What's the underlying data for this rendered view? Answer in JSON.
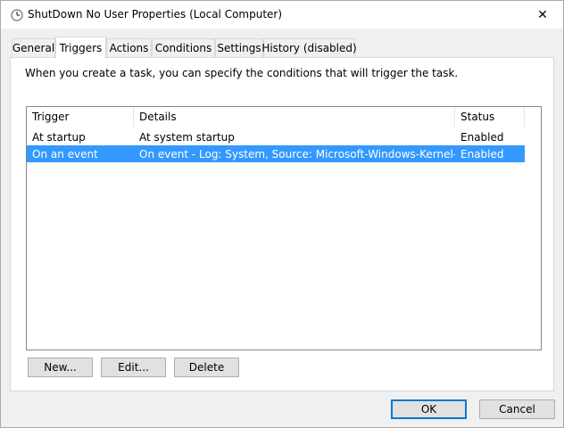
{
  "window": {
    "title": "ShutDown No User Properties (Local Computer)",
    "close_label": "✕"
  },
  "tabs": [
    {
      "label": "General",
      "active": false
    },
    {
      "label": "Triggers",
      "active": true
    },
    {
      "label": "Actions",
      "active": false
    },
    {
      "label": "Conditions",
      "active": false
    },
    {
      "label": "Settings",
      "active": false
    },
    {
      "label": "History (disabled)",
      "active": false
    }
  ],
  "triggers_page": {
    "intro": "When you create a task, you can specify the conditions that will trigger the task.",
    "columns": [
      "Trigger",
      "Details",
      "Status"
    ],
    "rows": [
      {
        "trigger": "At startup",
        "details": "At system startup",
        "status": "Enabled",
        "selected": false
      },
      {
        "trigger": "On an event",
        "details": "On event - Log: System, Source: Microsoft-Windows-Kernel-Po...",
        "status": "Enabled",
        "selected": true
      }
    ],
    "buttons": {
      "new": "New...",
      "edit": "Edit...",
      "delete": "Delete"
    }
  },
  "footer": {
    "ok": "OK",
    "cancel": "Cancel"
  },
  "icons": {
    "app": "clock-icon",
    "close": "close-icon"
  },
  "colors": {
    "selection": "#3399ff",
    "default_button_border": "#0078d7"
  }
}
